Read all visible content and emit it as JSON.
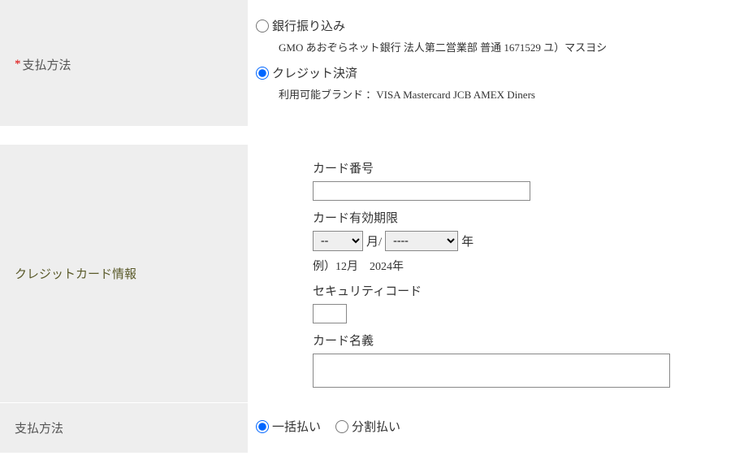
{
  "payment_method": {
    "required_mark": "*",
    "label": "支払方法",
    "option1": {
      "label": "銀行振り込み",
      "detail": "GMO あおぞらネット銀行 法人第二営業部 普通 1671529 ユ）マスヨシ"
    },
    "option2": {
      "label": "クレジット決済",
      "detail": "利用可能ブランド ：VISA Mastercard JCB AMEX Diners"
    }
  },
  "credit_card": {
    "section_label": "クレジットカード情報",
    "card_number_label": "カード番号",
    "expiry_label": "カード有効期限",
    "month_placeholder": "--",
    "month_suffix": "月/",
    "year_placeholder": "----",
    "year_suffix": "年",
    "expiry_example": "例）12月　2024年",
    "security_label": "セキュリティコード",
    "cardholder_label": "カード名義"
  },
  "payment_type": {
    "label": "支払方法",
    "option1": "一括払い",
    "option2": "分割払い"
  }
}
